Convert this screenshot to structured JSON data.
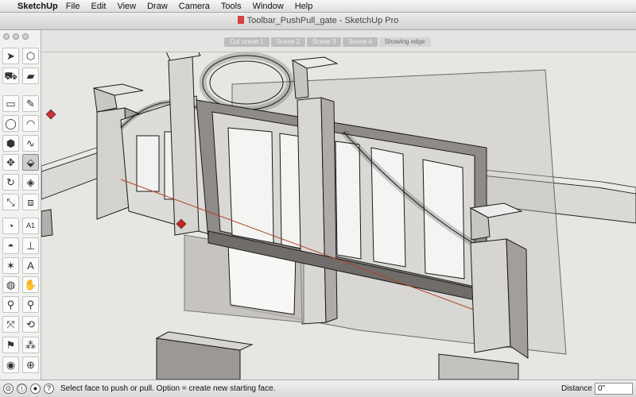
{
  "menubar": {
    "app_name": "SketchUp",
    "items": [
      "File",
      "Edit",
      "View",
      "Draw",
      "Camera",
      "Tools",
      "Window",
      "Help"
    ]
  },
  "window": {
    "title": "Toolbar_PushPull_gate - SketchUp Pro"
  },
  "scene_tabs": [
    {
      "label": "Cut scene 1"
    },
    {
      "label": "Scene 2"
    },
    {
      "label": "Scene 3"
    },
    {
      "label": "Scene 4"
    },
    {
      "label": "Showing edge"
    }
  ],
  "toolbar": {
    "tools": [
      {
        "name": "select-tool",
        "icon": "arrow-icon",
        "glyph": "➤"
      },
      {
        "name": "make-component-tool",
        "icon": "component-icon",
        "glyph": "⬡"
      },
      {
        "name": "paint-bucket-tool",
        "icon": "paint-bucket-icon",
        "glyph": "⛟"
      },
      {
        "name": "eraser-tool",
        "icon": "eraser-icon",
        "glyph": "▰"
      },
      {
        "name": "rectangle-tool",
        "icon": "rectangle-icon",
        "glyph": "▭"
      },
      {
        "name": "line-tool",
        "icon": "pencil-icon",
        "glyph": "✎"
      },
      {
        "name": "circle-tool",
        "icon": "circle-icon",
        "glyph": "◯"
      },
      {
        "name": "arc-tool",
        "icon": "arc-icon",
        "glyph": "◠"
      },
      {
        "name": "polygon-tool",
        "icon": "polygon-icon",
        "glyph": "⬢"
      },
      {
        "name": "freehand-tool",
        "icon": "freehand-icon",
        "glyph": "∿"
      },
      {
        "name": "move-tool",
        "icon": "move-icon",
        "glyph": "✥"
      },
      {
        "name": "push-pull-tool",
        "icon": "push-pull-icon",
        "glyph": "⬙"
      },
      {
        "name": "rotate-tool",
        "icon": "rotate-icon",
        "glyph": "↻"
      },
      {
        "name": "follow-me-tool",
        "icon": "follow-me-icon",
        "glyph": "◈"
      },
      {
        "name": "scale-tool",
        "icon": "scale-icon",
        "glyph": "⤡"
      },
      {
        "name": "offset-tool",
        "icon": "offset-icon",
        "glyph": "⧈"
      },
      {
        "name": "tape-measure-tool",
        "icon": "tape-measure-icon",
        "glyph": "◔"
      },
      {
        "name": "text-tool",
        "icon": "text-icon",
        "glyph": "A1"
      },
      {
        "name": "protractor-tool",
        "icon": "protractor-icon",
        "glyph": "◓"
      },
      {
        "name": "axes-tool",
        "icon": "axes-icon",
        "glyph": "⊥"
      },
      {
        "name": "dimension-tool",
        "icon": "dimension-icon",
        "glyph": "✶"
      },
      {
        "name": "3d-text-tool",
        "icon": "3d-text-icon",
        "glyph": "A"
      },
      {
        "name": "orbit-tool",
        "icon": "orbit-icon",
        "glyph": "◍"
      },
      {
        "name": "pan-tool",
        "icon": "hand-icon",
        "glyph": "✋"
      },
      {
        "name": "zoom-tool",
        "icon": "magnifier-icon",
        "glyph": "⚲"
      },
      {
        "name": "zoom-window-tool",
        "icon": "zoom-window-icon",
        "glyph": "⚲"
      },
      {
        "name": "zoom-extents-tool",
        "icon": "zoom-extents-icon",
        "glyph": "⤧"
      },
      {
        "name": "previous-view-tool",
        "icon": "previous-view-icon",
        "glyph": "⟲"
      },
      {
        "name": "position-camera-tool",
        "icon": "position-camera-icon",
        "glyph": "⚑"
      },
      {
        "name": "walk-tool",
        "icon": "footprints-icon",
        "glyph": "⁂"
      },
      {
        "name": "look-around-tool",
        "icon": "eye-icon",
        "glyph": "◉"
      },
      {
        "name": "section-plane-tool",
        "icon": "section-plane-icon",
        "glyph": "⊕"
      }
    ]
  },
  "status": {
    "message": "Select face to push or pull.  Option = create new starting face.",
    "measure_label": "Distance",
    "measure_value": "0\""
  },
  "colors": {
    "viewport_bg": "#e6e6e3",
    "face_gray": "#d9d8d4",
    "face_dark": "#8e8a87",
    "face_shadow": "#b5b1ae",
    "edge": "#1a1a1a",
    "selection_blue": "#4a6bb0"
  }
}
